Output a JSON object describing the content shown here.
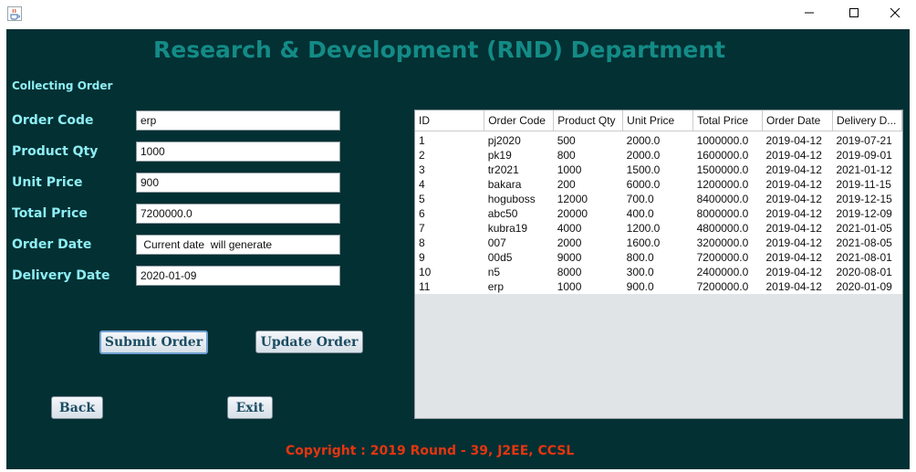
{
  "window": {
    "icon": "java-cup-icon",
    "controls": {
      "minimize": "minimize-icon",
      "maximize": "maximize-icon",
      "close": "close-icon"
    }
  },
  "header": {
    "title": "Research & Development (RND) Department",
    "subtitle": "Collecting Order"
  },
  "form": {
    "order_code": {
      "label": "Order Code",
      "value": "erp"
    },
    "product_qty": {
      "label": "Product Qty",
      "value": "1000"
    },
    "unit_price": {
      "label": "Unit Price",
      "value": "900"
    },
    "total_price": {
      "label": "Total Price",
      "value": "7200000.0"
    },
    "order_date": {
      "label": "Order Date",
      "value": " Current date  will generate"
    },
    "delivery_date": {
      "label": "Delivery Date",
      "value": "2020-01-09"
    }
  },
  "buttons": {
    "submit": "Submit Order",
    "update": "Update Order",
    "back": "Back",
    "exit": "Exit"
  },
  "table": {
    "columns": [
      "ID",
      "Order Code",
      "Product Qty",
      "Unit Price",
      "Total Price",
      "Order Date",
      "Delivery D..."
    ],
    "rows": [
      [
        "1",
        "pj2020",
        "500",
        "2000.0",
        "1000000.0",
        "2019-04-12",
        "2019-07-21"
      ],
      [
        "2",
        "pk19",
        "800",
        "2000.0",
        "1600000.0",
        "2019-04-12",
        "2019-09-01"
      ],
      [
        "3",
        "tr2021",
        "1000",
        "1500.0",
        "1500000.0",
        "2019-04-12",
        "2021-01-12"
      ],
      [
        "4",
        "bakara",
        "200",
        "6000.0",
        "1200000.0",
        "2019-04-12",
        "2019-11-15"
      ],
      [
        "5",
        "hoguboss",
        "12000",
        "700.0",
        "8400000.0",
        "2019-04-12",
        "2019-12-15"
      ],
      [
        "6",
        "abc50",
        "20000",
        "400.0",
        "8000000.0",
        "2019-04-12",
        "2019-12-09"
      ],
      [
        "7",
        "kubra19",
        "4000",
        "1200.0",
        "4800000.0",
        "2019-04-12",
        "2021-01-05"
      ],
      [
        "8",
        "007",
        "2000",
        "1600.0",
        "3200000.0",
        "2019-04-12",
        "2021-08-05"
      ],
      [
        "9",
        "00d5",
        "9000",
        "800.0",
        "7200000.0",
        "2019-04-12",
        "2021-08-01"
      ],
      [
        "10",
        "n5",
        "8000",
        "300.0",
        "2400000.0",
        "2019-04-12",
        "2020-08-01"
      ],
      [
        "11",
        "erp",
        "1000",
        "900.0",
        "7200000.0",
        "2019-04-12",
        "2020-01-09"
      ]
    ]
  },
  "footer": {
    "copyright": "Copyright : 2019 Round - 39, J2EE, CCSL"
  },
  "colors": {
    "background": "#033033",
    "heading": "#138b86",
    "label": "#8eeef4",
    "copyright": "#e53510",
    "button_text": "#1b4d63"
  }
}
